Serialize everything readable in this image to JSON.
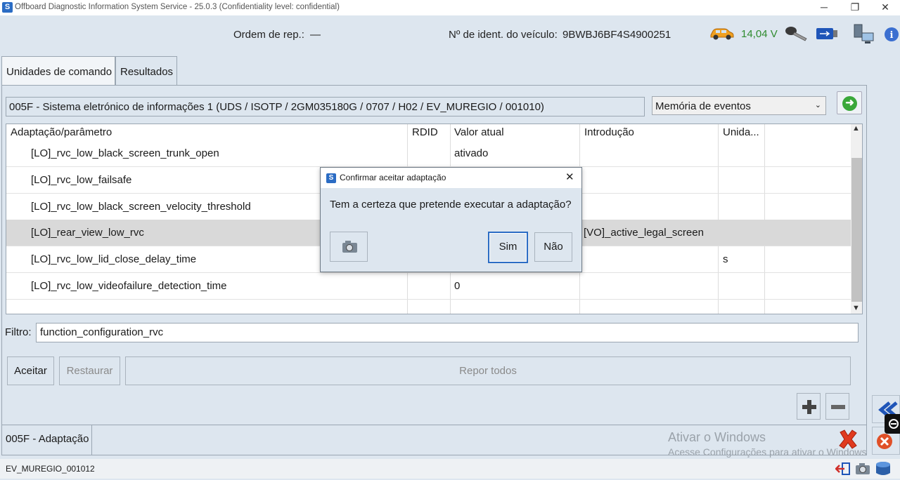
{
  "window": {
    "title": "Offboard Diagnostic Information System Service - 25.0.3 (Confidentiality level: confidential)",
    "app_icon": "S",
    "controls": {
      "minimize": "─",
      "maximize": "❐",
      "close": "✕"
    }
  },
  "header": {
    "repair_order_label": "Ordem de rep.:",
    "repair_order_value": "—",
    "vin_label": "Nº de ident. do veículo:",
    "vin_value": "9BWBJ6BF4S4900251",
    "voltage": "14,04 V",
    "voltage_color": "#2e8b2e",
    "icons": [
      "car-icon",
      "key-icon",
      "usb-icon",
      "network-icon",
      "info-icon"
    ]
  },
  "tabs": [
    {
      "label": "Unidades de comando",
      "active": true
    },
    {
      "label": "Resultados",
      "active": false
    }
  ],
  "ecu": {
    "label": "005F - Sistema eletrónico de informações 1  (UDS / ISOTP / 2GM035180G / 0707 / H02 / EV_MUREGIO / 001010)",
    "memory_select": "Memória de eventos"
  },
  "table": {
    "columns": [
      "Adaptação/parâmetro",
      "RDID",
      "Valor atual",
      "Introdução",
      "Unida..."
    ],
    "rows": [
      {
        "param": "[LO]_rvc_low_black_screen_trunk_open",
        "rdid": "",
        "value": "ativado",
        "input": "",
        "unit": "",
        "selected": false
      },
      {
        "param": "[LO]_rvc_low_failsafe",
        "rdid": "",
        "value": "",
        "input": "",
        "unit": "",
        "selected": false
      },
      {
        "param": "[LO]_rvc_low_black_screen_velocity_threshold",
        "rdid": "",
        "value": "",
        "input": "",
        "unit": "",
        "selected": false
      },
      {
        "param": "[LO]_rear_view_low_rvc",
        "rdid": "",
        "value": "",
        "input": "[VO]_active_legal_screen",
        "unit": "",
        "selected": true
      },
      {
        "param": "[LO]_rvc_low_lid_close_delay_time",
        "rdid": "",
        "value": "",
        "input": "",
        "unit": "s",
        "selected": false
      },
      {
        "param": "[LO]_rvc_low_videofailure_detection_time",
        "rdid": "",
        "value": "0",
        "input": "",
        "unit": "",
        "selected": false
      },
      {
        "param": "",
        "rdid": "",
        "value": "",
        "input": "",
        "unit": "",
        "selected": false
      }
    ]
  },
  "filter": {
    "label": "Filtro:",
    "value": "function_configuration_rvc"
  },
  "actions": {
    "accept": "Aceitar",
    "restore": "Restaurar",
    "reset_all": "Repor todos"
  },
  "bottom": {
    "adaptation_label": "005F - Adaptação",
    "watermark_title": "Ativar o Windows",
    "watermark_sub": "Acesse Configurações para ativar o Windows."
  },
  "status": {
    "text": "EV_MUREGIO_001012"
  },
  "dialog": {
    "title": "Confirmar aceitar adaptação",
    "message": "Tem a certeza que pretende executar a adaptação?",
    "yes": "Sim",
    "no": "Não",
    "close": "✕"
  },
  "colors": {
    "accent": "#2b6cc4",
    "error": "#e03a1e",
    "ok": "#3aa83a"
  }
}
